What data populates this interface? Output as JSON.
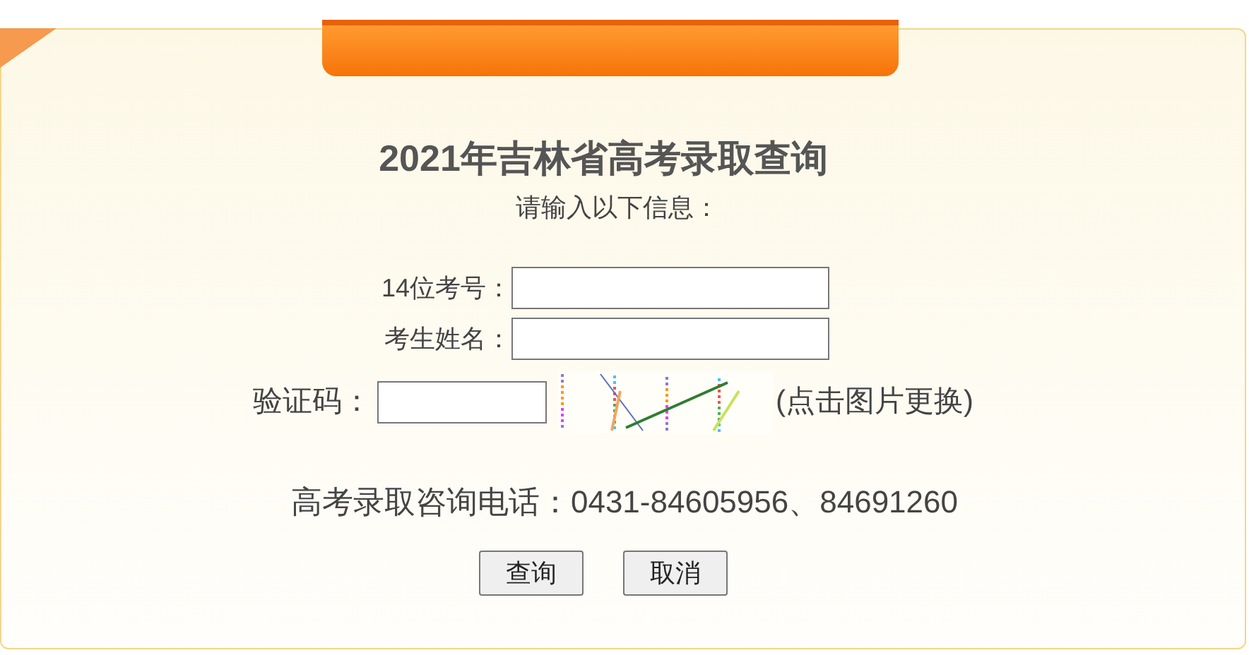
{
  "title": "2021年吉林省高考录取查询",
  "subtitle": "请输入以下信息：",
  "fields": [
    {
      "label": "14位考号："
    },
    {
      "label": "考生姓名："
    }
  ],
  "captcha": {
    "label": "验证码：",
    "hint": "(点击图片更换)"
  },
  "hotline": "高考录取咨询电话：0431-84605956、84691260",
  "buttons": [
    "查询",
    "取消"
  ]
}
